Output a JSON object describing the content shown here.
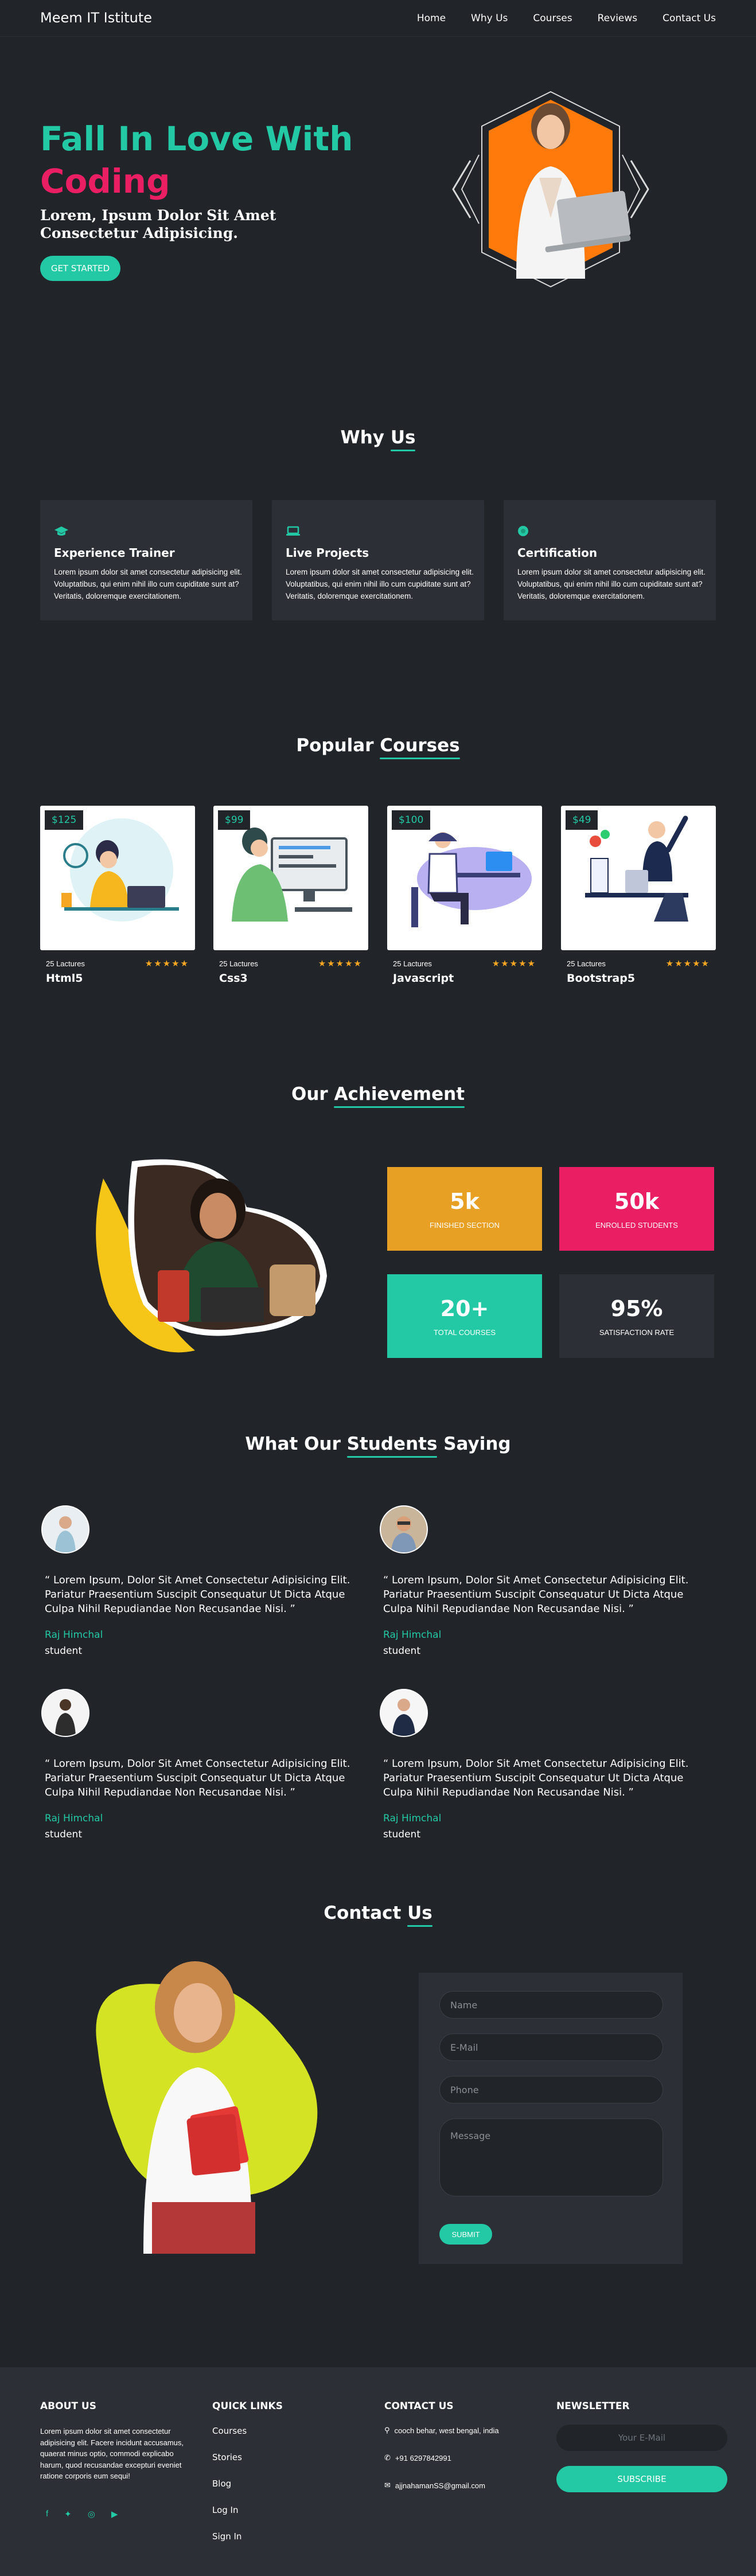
{
  "navbar": {
    "brand": "Meem IT Istitute",
    "links": [
      "Home",
      "Why Us",
      "Courses",
      "Reviews",
      "Contact Us"
    ]
  },
  "hero": {
    "title_line1": "Fall In Love With",
    "title_line2": "Coding",
    "subtitle": "Lorem, Ipsum Dolor Sit Amet Consectetur Adipisicing.",
    "cta": "GET STARTED"
  },
  "why_us": {
    "title_plain": "Why ",
    "title_highlight": "Us",
    "cards": [
      {
        "icon": "graduation-cap-icon",
        "title": "Experience Trainer",
        "text": "Lorem ipsum dolor sit amet consectetur adipisicing elit. Voluptatibus, qui enim nihil illo cum cupiditate sunt at? Veritatis, doloremque exercitationem."
      },
      {
        "icon": "laptop-icon",
        "title": "Live Projects",
        "text": "Lorem ipsum dolor sit amet consectetur adipisicing elit. Voluptatibus, qui enim nihil illo cum cupiditate sunt at? Veritatis, doloremque exercitationem."
      },
      {
        "icon": "certificate-icon",
        "title": "Certification",
        "text": "Lorem ipsum dolor sit amet consectetur adipisicing elit. Voluptatibus, qui enim nihil illo cum cupiditate sunt at? Veritatis, doloremque exercitationem."
      }
    ]
  },
  "courses": {
    "title_plain": "Popular ",
    "title_highlight": "Courses",
    "items": [
      {
        "price": "$125",
        "lectures": "25 Lactures",
        "name": "Html5",
        "stars": "★★★★★"
      },
      {
        "price": "$99",
        "lectures": "25 Lactures",
        "name": "Css3",
        "stars": "★★★★★"
      },
      {
        "price": "$100",
        "lectures": "25 Lactures",
        "name": "Javascript",
        "stars": "★★★★★"
      },
      {
        "price": "$49",
        "lectures": "25 Lactures",
        "name": "Bootstrap5",
        "stars": "★★★★★"
      }
    ]
  },
  "achievement": {
    "title_plain": "Our ",
    "title_highlight": "Achievement",
    "stats": [
      {
        "num": "5k",
        "label": "FINISHED SECTION",
        "color": "#e8a024"
      },
      {
        "num": "50k",
        "label": "ENROLLED STUDENTS",
        "color": "#e91e63"
      },
      {
        "num": "20+",
        "label": "TOTAL COURSES",
        "color": "#23c9a5"
      },
      {
        "num": "95%",
        "label": "SATISFACTION RATE",
        "color": "#2c3036"
      }
    ]
  },
  "testimonials": {
    "title_plain": "What Our ",
    "title_highlight": "Students",
    "title_end": " Saying",
    "items": [
      {
        "quote": "“ Lorem Ipsum, Dolor Sit Amet Consectetur Adipisicing Elit. Pariatur Praesentium Suscipit Consequatur Ut Dicta Atque Culpa Nihil Repudiandae Non Recusandae Nisi. ”",
        "name": "Raj Himchal",
        "role": "student"
      },
      {
        "quote": "“ Lorem Ipsum, Dolor Sit Amet Consectetur Adipisicing Elit. Pariatur Praesentium Suscipit Consequatur Ut Dicta Atque Culpa Nihil Repudiandae Non Recusandae Nisi. ”",
        "name": "Raj Himchal",
        "role": "student"
      },
      {
        "quote": "“ Lorem Ipsum, Dolor Sit Amet Consectetur Adipisicing Elit. Pariatur Praesentium Suscipit Consequatur Ut Dicta Atque Culpa Nihil Repudiandae Non Recusandae Nisi. ”",
        "name": "Raj Himchal",
        "role": "student"
      },
      {
        "quote": "“ Lorem Ipsum, Dolor Sit Amet Consectetur Adipisicing Elit. Pariatur Praesentium Suscipit Consequatur Ut Dicta Atque Culpa Nihil Repudiandae Non Recusandae Nisi. ”",
        "name": "Raj Himchal",
        "role": "student"
      }
    ]
  },
  "contact": {
    "title_plain": "Contact ",
    "title_highlight": "Us",
    "name_placeholder": "Name",
    "email_placeholder": "E-Mail",
    "phone_placeholder": "Phone",
    "message_placeholder": "Message",
    "submit": "SUBMIT"
  },
  "footer": {
    "about_title": "ABOUT US",
    "about_text": "Lorem ipsum dolor sit amet consectetur adipisicing elit. Facere incidunt accusamus, quaerat minus optio, commodi explicabo harum, quod recusandae excepturi eveniet ratione corporis eum sequi!",
    "links_title": "QUICK LINKS",
    "links": [
      "Courses",
      "Stories",
      "Blog",
      "Log In",
      "Sign In"
    ],
    "contact_title": "CONTACT US",
    "address": "cooch behar, west bengal, india",
    "phone": "+91 6297842991",
    "email": "ajjnahamanSS@gmail.com",
    "newsletter_title": "NEWSLETTER",
    "newsletter_placeholder": "Your E-Mail",
    "subscribe": "SUBSCRIBE"
  },
  "colors": {
    "accent": "#23c9a5",
    "pink": "#e91e63",
    "orange": "#f5730f",
    "bg": "#212529",
    "card": "#2c3036"
  }
}
